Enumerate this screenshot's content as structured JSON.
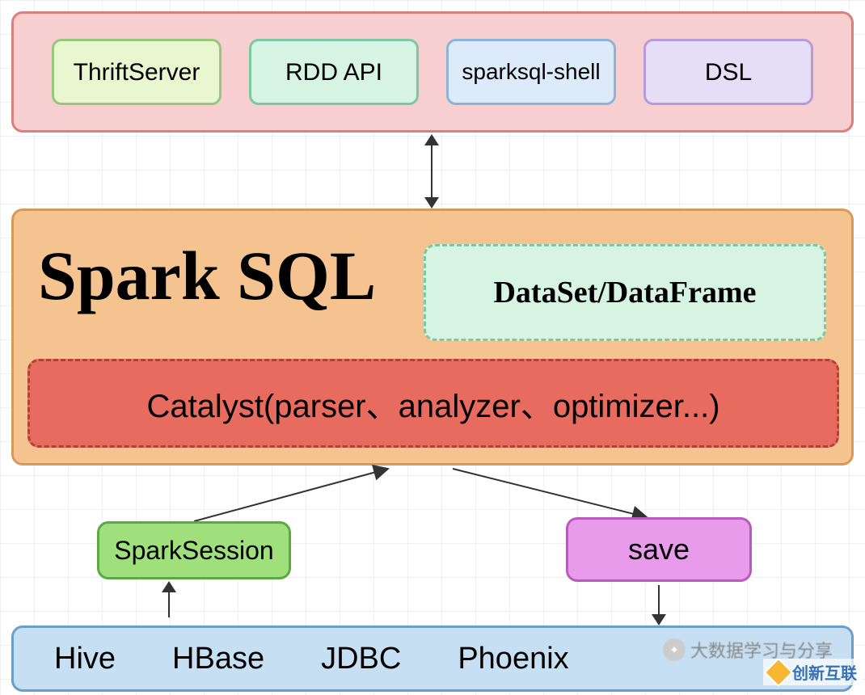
{
  "top": {
    "thrift": "ThriftServer",
    "rdd": "RDD API",
    "shell": "sparksql-shell",
    "dsl": "DSL"
  },
  "spark": {
    "title": "Spark SQL",
    "dataset": "DataSet/DataFrame",
    "catalyst": "Catalyst(parser、analyzer、optimizer...)"
  },
  "middle": {
    "session": "SparkSession",
    "save": "save"
  },
  "sources": {
    "hive": "Hive",
    "hbase": "HBase",
    "jdbc": "JDBC",
    "phoenix": "Phoenix"
  },
  "watermark": {
    "text1": "大数据学习与分享",
    "text2": "创新互联"
  }
}
